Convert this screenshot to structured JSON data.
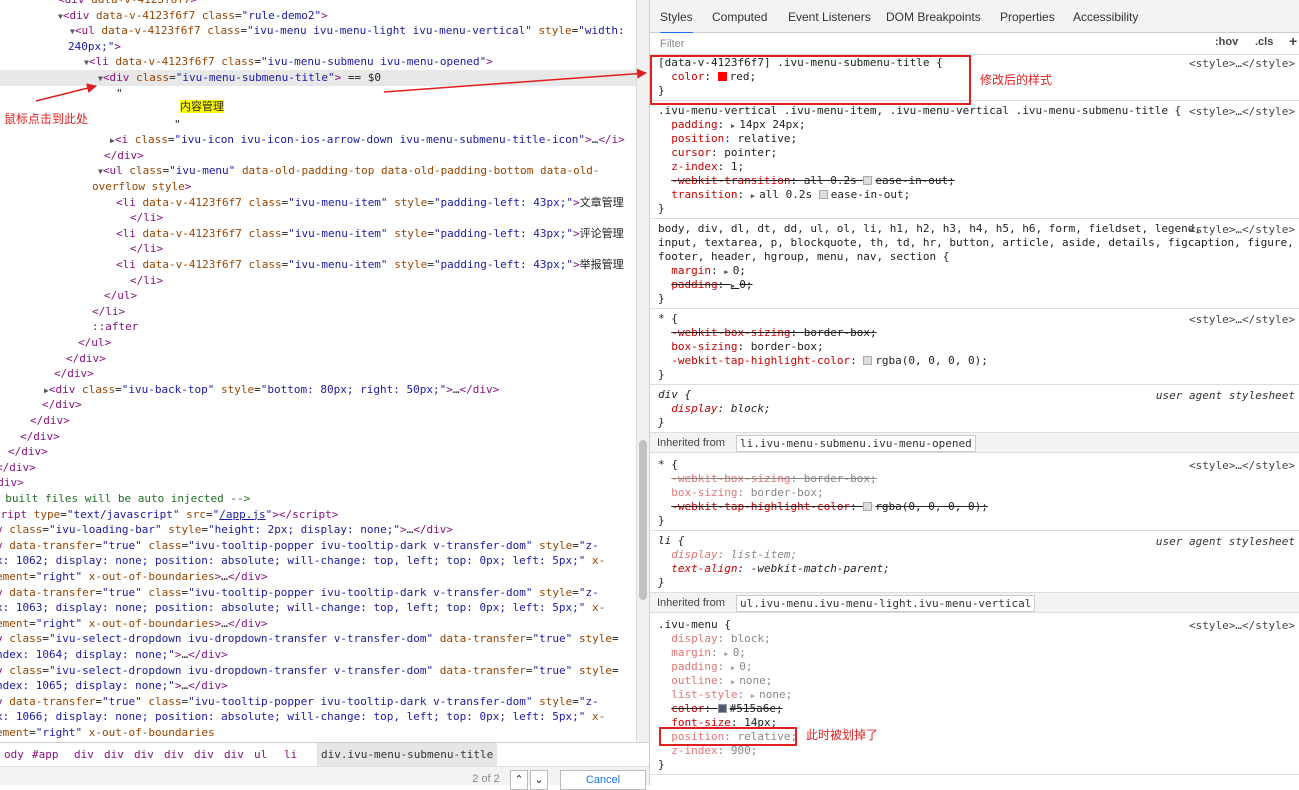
{
  "elements_panel": {
    "lines": [
      {
        "indent": 58,
        "html": "<span class='tag'>&lt;div</span> <span class='an'>data-v-4123f6f7</span><span class='tag'>&gt;</span>"
      },
      {
        "indent": 58,
        "tri": "▼",
        "html": "<span class='tag'>&lt;div</span> <span class='an'>data-v-4123f6f7</span> <span class='an'>class</span>=<span class='av'>\"rule-demo2\"</span><span class='tag'>&gt;</span>"
      },
      {
        "indent": 70,
        "tri": "▼",
        "html": "<span class='tag'>&lt;ul</span> <span class='an'>data-v-4123f6f7</span> <span class='an'>class</span>=<span class='av'>\"ivu-menu ivu-menu-light ivu-menu-vertical\"</span> <span class='an'>style</span>=<span class='av'>\"width:</span>"
      },
      {
        "indent": 68,
        "html": "<span class='av'>240px;\"</span><span class='tag'>&gt;</span>"
      },
      {
        "indent": 84,
        "tri": "▼",
        "html": "<span class='tag'>&lt;li</span> <span class='an'>data-v-4123f6f7</span> <span class='an'>class</span>=<span class='av'>\"ivu-menu-submenu ivu-menu-opened\"</span><span class='tag'>&gt;</span>"
      },
      {
        "indent": 98,
        "tri": "▼",
        "sel": true,
        "html": "<span class='tag'>&lt;div</span> <span class='an'>class</span>=<span class='av'>\"ivu-menu-submenu-title\"</span><span class='tag'>&gt;</span> == $0"
      },
      {
        "indent": 116,
        "html": "<span class='tx'>\"</span>"
      },
      {
        "indent": 180,
        "html": "<span class='hl'>内容管理</span>"
      },
      {
        "indent": 174,
        "html": "<span class='tx'>\"</span>"
      },
      {
        "indent": 110,
        "tri": "▶",
        "html": "<span class='tag'>&lt;i</span> <span class='an'>class</span>=<span class='av'>\"ivu-icon ivu-icon-ios-arrow-down ivu-menu-submenu-title-icon\"</span><span class='tag'>&gt;</span>…<span class='tag'>&lt;/i&gt;</span>"
      },
      {
        "indent": 104,
        "html": "<span class='tag'>&lt;/div&gt;</span>"
      },
      {
        "indent": 98,
        "tri": "▼",
        "html": "<span class='tag'>&lt;ul</span> <span class='an'>class</span>=<span class='av'>\"ivu-menu\"</span> <span class='an'>data-old-padding-top data-old-padding-bottom data-old-</span>"
      },
      {
        "indent": 92,
        "html": "<span class='an'>overflow style</span><span class='tag'>&gt;</span>"
      },
      {
        "indent": 116,
        "html": "<span class='tag'>&lt;li</span> <span class='an'>data-v-4123f6f7</span> <span class='an'>class</span>=<span class='av'>\"ivu-menu-item\"</span> <span class='an'>style</span>=<span class='av'>\"padding-left: 43px;\"</span><span class='tag'>&gt;</span><span class='cjk'>文章管理</span>"
      },
      {
        "indent": 130,
        "html": "<span class='tag'>&lt;/li&gt;</span>"
      },
      {
        "indent": 116,
        "html": "<span class='tag'>&lt;li</span> <span class='an'>data-v-4123f6f7</span> <span class='an'>class</span>=<span class='av'>\"ivu-menu-item\"</span> <span class='an'>style</span>=<span class='av'>\"padding-left: 43px;\"</span><span class='tag'>&gt;</span><span class='cjk'>评论管理</span>"
      },
      {
        "indent": 130,
        "html": "<span class='tag'>&lt;/li&gt;</span>"
      },
      {
        "indent": 116,
        "html": "<span class='tag'>&lt;li</span> <span class='an'>data-v-4123f6f7</span> <span class='an'>class</span>=<span class='av'>\"ivu-menu-item\"</span> <span class='an'>style</span>=<span class='av'>\"padding-left: 43px;\"</span><span class='tag'>&gt;</span><span class='cjk'>举报管理</span>"
      },
      {
        "indent": 130,
        "html": "<span class='tag'>&lt;/li&gt;</span>"
      },
      {
        "indent": 104,
        "html": "<span class='tag'>&lt;/ul&gt;</span>"
      },
      {
        "indent": 92,
        "html": "<span class='tag'>&lt;/li&gt;</span>"
      },
      {
        "indent": 92,
        "html": "<span class='tag'>::after</span>"
      },
      {
        "indent": 78,
        "html": "<span class='tag'>&lt;/ul&gt;</span>"
      },
      {
        "indent": 66,
        "html": "<span class='tag'>&lt;/div&gt;</span>"
      },
      {
        "indent": 54,
        "html": "<span class='tag'>&lt;/div&gt;</span>"
      },
      {
        "indent": 44,
        "tri": "▶",
        "html": "<span class='tag'>&lt;div</span> <span class='an'>class</span>=<span class='av'>\"ivu-back-top\"</span> <span class='an'>style</span>=<span class='av'>\"bottom: 80px; right: 50px;\"</span><span class='tag'>&gt;</span>…<span class='tag'>&lt;/div&gt;</span>"
      },
      {
        "indent": 42,
        "html": "<span class='tag'>&lt;/div&gt;</span>"
      },
      {
        "indent": 30,
        "html": "<span class='tag'>&lt;/div&gt;</span>"
      },
      {
        "indent": 20,
        "html": "<span class='tag'>&lt;/div&gt;</span>"
      },
      {
        "indent": 8,
        "html": "<span class='tag'>&lt;/div&gt;</span>"
      },
      {
        "indent": -4,
        "html": "<span class='tag'>&lt;/div&gt;</span>"
      },
      {
        "indent": -16,
        "html": "<span class='tag'>&lt;/div&gt;</span>"
      },
      {
        "indent": -8,
        "html": "<span class='cm'>- built files will be auto injected --&gt;</span>"
      },
      {
        "indent": -6,
        "html": "<span class='tag'>cript</span> <span class='an'>type</span>=<span class='av'>\"text/javascript\"</span> <span class='an'>src</span>=<span class='av'>\"</span><span class='lk'>/app.js</span><span class='av'>\"</span><span class='tag'>&gt;&lt;/script&gt;</span>"
      },
      {
        "indent": -4,
        "html": "<span class='tag'>v</span> <span class='an'>class</span>=<span class='av'>\"ivu-loading-bar\"</span> <span class='an'>style</span>=<span class='av'>\"height: 2px; display: none;\"</span><span class='tag'>&gt;</span>…<span class='tag'>&lt;/div&gt;</span>"
      },
      {
        "indent": -4,
        "html": "<span class='tag'>v</span> <span class='an'>data-transfer</span>=<span class='av'>\"true\"</span> <span class='an'>class</span>=<span class='av'>\"ivu-tooltip-popper ivu-tooltip-dark v-transfer-dom\"</span> <span class='an'>style</span>=<span class='av'>\"z-</span>"
      },
      {
        "indent": -4,
        "html": "<span class='av'>x: 1062; display: none; position: absolute; will-change: top, left; top: 0px; left: 5px;\"</span> <span class='an'>x-</span>"
      },
      {
        "indent": -4,
        "html": "<span class='an'>ement</span>=<span class='av'>\"right\"</span> <span class='an'>x-out-of-boundaries</span><span class='tag'>&gt;</span>…<span class='tag'>&lt;/div&gt;</span>"
      },
      {
        "indent": -4,
        "html": "<span class='tag'>v</span> <span class='an'>data-transfer</span>=<span class='av'>\"true\"</span> <span class='an'>class</span>=<span class='av'>\"ivu-tooltip-popper ivu-tooltip-dark v-transfer-dom\"</span> <span class='an'>style</span>=<span class='av'>\"z-</span>"
      },
      {
        "indent": -4,
        "html": "<span class='av'>x: 1063; display: none; position: absolute; will-change: top, left; top: 0px; left: 5px;\"</span> <span class='an'>x-</span>"
      },
      {
        "indent": -4,
        "html": "<span class='an'>ement</span>=<span class='av'>\"right\"</span> <span class='an'>x-out-of-boundaries</span><span class='tag'>&gt;</span>…<span class='tag'>&lt;/div&gt;</span>"
      },
      {
        "indent": -4,
        "html": "<span class='tag'>v</span> <span class='an'>class</span>=<span class='av'>\"ivu-select-dropdown ivu-dropdown-transfer v-transfer-dom\"</span> <span class='an'>data-transfer</span>=<span class='av'>\"true\"</span> <span class='an'>style</span>="
      },
      {
        "indent": -4,
        "html": "<span class='av'>ndex: 1064; display: none;\"</span><span class='tag'>&gt;</span>…<span class='tag'>&lt;/div&gt;</span>"
      },
      {
        "indent": -4,
        "html": "<span class='tag'>v</span> <span class='an'>class</span>=<span class='av'>\"ivu-select-dropdown ivu-dropdown-transfer v-transfer-dom\"</span> <span class='an'>data-transfer</span>=<span class='av'>\"true\"</span> <span class='an'>style</span>="
      },
      {
        "indent": -4,
        "html": "<span class='av'>ndex: 1065; display: none;\"</span><span class='tag'>&gt;</span>…<span class='tag'>&lt;/div&gt;</span>"
      },
      {
        "indent": -4,
        "html": "<span class='tag'>v</span> <span class='an'>data-transfer</span>=<span class='av'>\"true\"</span> <span class='an'>class</span>=<span class='av'>\"ivu-tooltip-popper ivu-tooltip-dark v-transfer-dom\"</span> <span class='an'>style</span>=<span class='av'>\"z-</span>"
      },
      {
        "indent": -4,
        "html": "<span class='av'>x: 1066; display: none; position: absolute; will-change: top, left; top: 0px; left: 5px;\"</span> <span class='an'>x-</span>"
      },
      {
        "indent": -4,
        "html": "<span class='an'>ement</span>=<span class='av'>\"right\"</span> <span class='an'>x-out-of-boundaries</span>"
      }
    ]
  },
  "breadcrumbs": [
    "ody",
    "#app",
    "div",
    "div",
    "div",
    "div",
    "div",
    "div",
    "ul",
    "li",
    "div.ivu-menu-submenu-title"
  ],
  "search": {
    "count": "2 of 2",
    "cancel": "Cancel"
  },
  "tabs": [
    "Styles",
    "Computed",
    "Event Listeners",
    "DOM Breakpoints",
    "Properties",
    "Accessibility"
  ],
  "filter": {
    "placeholder": "Filter",
    "hov": ":hov",
    "cls": ".cls",
    "plus": "+"
  },
  "style_rules": [
    {
      "selector": "[data-v-4123f6f7] .ivu-menu-submenu-title {",
      "source": "<style>…</style>",
      "props": [
        {
          "name": "color",
          "value": "red;",
          "swatch": "red"
        }
      ]
    },
    {
      "selector": ".ivu-menu-vertical .ivu-menu-item, .ivu-menu-vertical .ivu-menu-submenu-title {",
      "source": "<style>…</style>",
      "props": [
        {
          "name": "padding",
          "value": "14px 24px;",
          "tri": true
        },
        {
          "name": "position",
          "value": "relative;"
        },
        {
          "name": "cursor",
          "value": "pointer;"
        },
        {
          "name": "z-index",
          "value": "1;"
        },
        {
          "name": "-webkit-transition",
          "value": "all 0.2s ",
          "ease": "ease-in-out;",
          "strike": true
        },
        {
          "name": "transition",
          "value": "all 0.2s ",
          "ease": "ease-in-out;",
          "tri": true
        }
      ]
    },
    {
      "selector": "body, div, dl, dt, dd, ul, ol, li, h1, h2, h3, h4, h5, h6, form, fieldset, legend,",
      "selector2": "input, textarea, p, blockquote, th, td, hr, button, article, aside, details, figcaption, figure,",
      "selector3": "footer, header, hgroup, menu, nav, section {",
      "source": "<style>…</style>",
      "props": [
        {
          "name": "margin",
          "value": "0;",
          "tri": true
        },
        {
          "name": "padding",
          "value": "0;",
          "tri": true,
          "strike": true
        }
      ]
    },
    {
      "selector": "* {",
      "source": "<style>…</style>",
      "props": [
        {
          "name": "-webkit-box-sizing",
          "value": "border-box;",
          "strike": true
        },
        {
          "name": "box-sizing",
          "value": "border-box;"
        },
        {
          "name": "-webkit-tap-highlight-color",
          "value": "rgba(0, 0, 0, 0);",
          "swatch": "gray"
        }
      ]
    },
    {
      "selector": "div {",
      "source": "user agent stylesheet",
      "ua": true,
      "props": [
        {
          "name": "display",
          "value": "block;"
        }
      ]
    }
  ],
  "inherited_1": {
    "label": "Inherited from",
    "selector": "li.ivu-menu-submenu.ivu-menu-opened"
  },
  "inherited_rules_1": [
    {
      "selector": "* {",
      "source": "<style>…</style>",
      "props": [
        {
          "name": "-webkit-box-sizing",
          "value": "border-box;",
          "strike": true,
          "dim": true
        },
        {
          "name": "box-sizing",
          "value": "border-box;",
          "dim": true
        },
        {
          "name": "-webkit-tap-highlight-color",
          "value": "rgba(0, 0, 0, 0);",
          "swatch": "gray",
          "strike": true
        }
      ]
    },
    {
      "selector": "li {",
      "source": "user agent stylesheet",
      "ua": true,
      "props": [
        {
          "name": "display",
          "value": "list-item;",
          "dim": true
        },
        {
          "name": "text-align",
          "value": "-webkit-match-parent;"
        }
      ]
    }
  ],
  "inherited_2": {
    "label": "Inherited from",
    "selector": "ul.ivu-menu.ivu-menu-light.ivu-menu-vertical"
  },
  "inherited_rules_2": [
    {
      "selector": ".ivu-menu {",
      "source": "<style>…</style>",
      "props": [
        {
          "name": "display",
          "value": "block;",
          "dim": true
        },
        {
          "name": "margin",
          "value": "0;",
          "dim": true,
          "tri": true
        },
        {
          "name": "padding",
          "value": "0;",
          "dim": true,
          "tri": true
        },
        {
          "name": "outline",
          "value": "none;",
          "dim": true,
          "tri": true
        },
        {
          "name": "list-style",
          "value": "none;",
          "dim": true,
          "tri": true
        },
        {
          "name": "color",
          "value": "#515a6e;",
          "swatch": "dark",
          "strike": true
        },
        {
          "name": "font-size",
          "value": "14px;"
        },
        {
          "name": "position",
          "value": "relative;",
          "dim": true
        },
        {
          "name": "z-index",
          "value": "900;",
          "dim": true
        }
      ]
    }
  ],
  "annotations": {
    "modified_style": "修改后的样式",
    "click_here": "鼠标点击到此处",
    "struck_out": "此时被划掉了"
  },
  "colors": {
    "accent": "#e02020",
    "tab_active": "#1a73e8"
  }
}
